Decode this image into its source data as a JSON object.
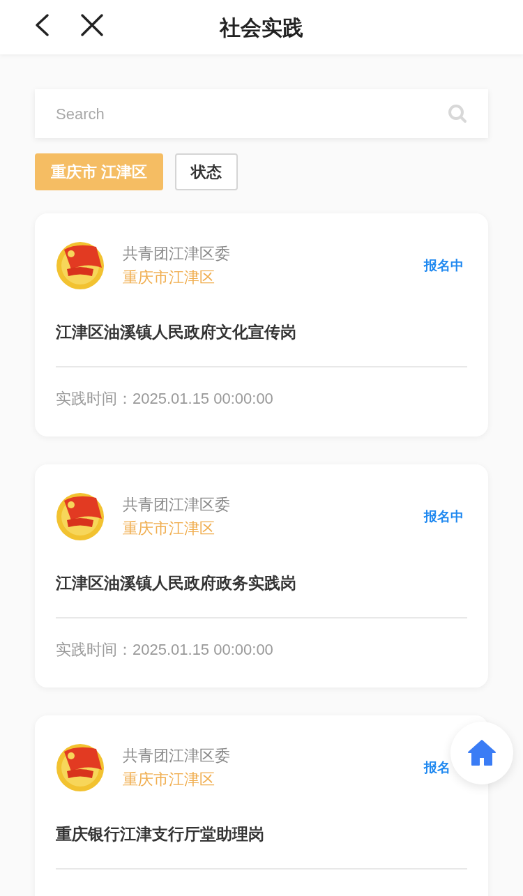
{
  "header": {
    "title": "社会实践"
  },
  "search": {
    "placeholder": "Search"
  },
  "filters": [
    {
      "label": "重庆市 江津区",
      "selected": true
    },
    {
      "label": "状态",
      "selected": false
    }
  ],
  "cards": [
    {
      "org": "共青团江津区委",
      "region": "重庆市江津区",
      "status": "报名中",
      "title": "江津区油溪镇人民政府文化宣传岗",
      "time": "实践时间：2025.01.15 00:00:00"
    },
    {
      "org": "共青团江津区委",
      "region": "重庆市江津区",
      "status": "报名中",
      "title": "江津区油溪镇人民政府政务实践岗",
      "time": "实践时间：2025.01.15 00:00:00"
    },
    {
      "org": "共青团江津区委",
      "region": "重庆市江津区",
      "status": "报名",
      "title": "重庆银行江津支行厅堂助理岗"
    }
  ]
}
